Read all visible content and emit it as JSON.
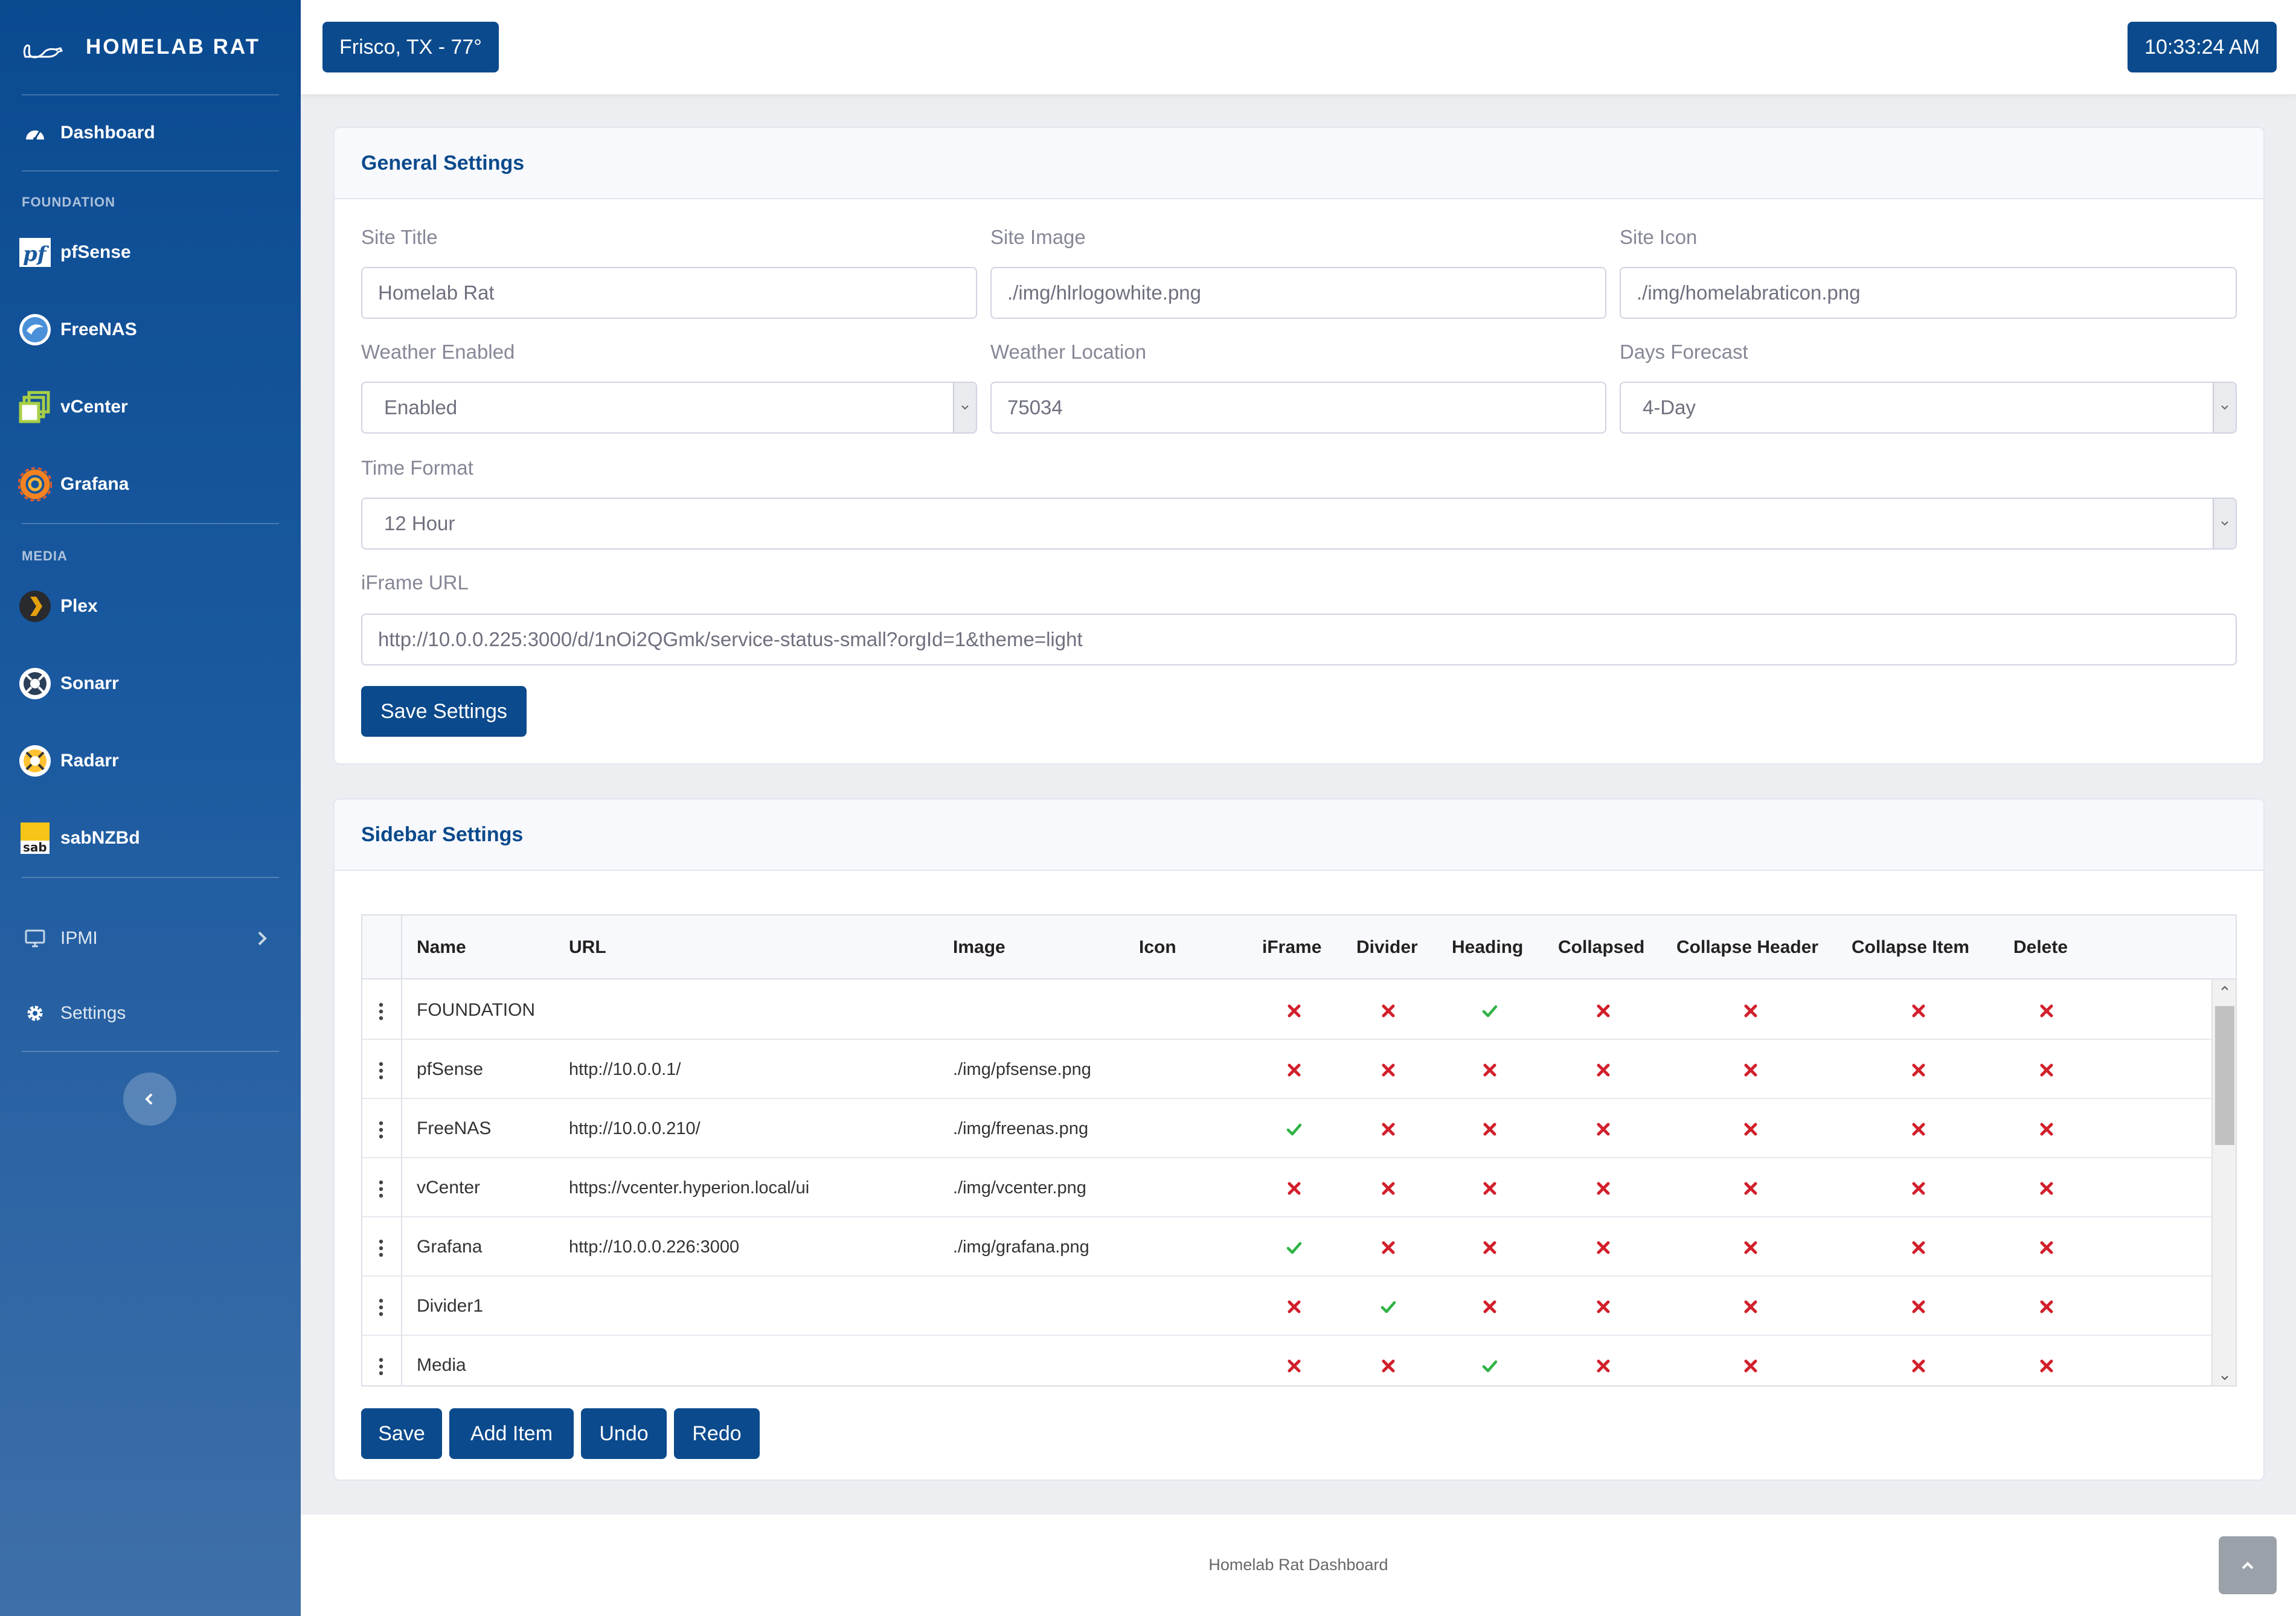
{
  "brand": {
    "name": "HOMELAB RAT"
  },
  "sidebar": {
    "dashboard": "Dashboard",
    "headings": {
      "foundation": "FOUNDATION",
      "media": "MEDIA"
    },
    "items": {
      "pfsense": "pfSense",
      "freenas": "FreeNAS",
      "vcenter": "vCenter",
      "grafana": "Grafana",
      "plex": "Plex",
      "sonarr": "Sonarr",
      "radarr": "Radarr",
      "sabnzbd": "sabNZBd",
      "ipmi": "IPMI",
      "settings": "Settings"
    },
    "sab_icon_text": "sab"
  },
  "topbar": {
    "weather": "Frisco, TX - 77°",
    "clock": "10:33:24 AM"
  },
  "general": {
    "title": "General Settings",
    "site_title": {
      "label": "Site Title",
      "value": "Homelab Rat"
    },
    "site_image": {
      "label": "Site Image",
      "value": "./img/hlrlogowhite.png"
    },
    "site_icon": {
      "label": "Site Icon",
      "value": "./img/homelabraticon.png"
    },
    "weather_enabled": {
      "label": "Weather Enabled",
      "value": "Enabled"
    },
    "weather_location": {
      "label": "Weather Location",
      "value": "75034"
    },
    "days_forecast": {
      "label": "Days Forecast",
      "value": "4-Day"
    },
    "time_format": {
      "label": "Time Format",
      "value": "12 Hour"
    },
    "iframe_url": {
      "label": "iFrame URL",
      "value": "http://10.0.0.225:3000/d/1nOi2QGmk/service-status-small?orgId=1&theme=light"
    },
    "save_label": "Save Settings"
  },
  "sidebar_settings": {
    "title": "Sidebar Settings",
    "columns": {
      "name": "Name",
      "url": "URL",
      "image": "Image",
      "icon": "Icon",
      "iframe": "iFrame",
      "divider": "Divider",
      "heading": "Heading",
      "collapsed": "Collapsed",
      "collapse_header": "Collapse Header",
      "collapse_item": "Collapse Item",
      "delete": "Delete"
    },
    "rows": [
      {
        "name": "FOUNDATION",
        "url": "",
        "image": "",
        "icon": "",
        "iframe": false,
        "divider": false,
        "heading": true,
        "collapsed": false,
        "collapse_header": false,
        "collapse_item": false,
        "delete": false
      },
      {
        "name": "pfSense",
        "url": "http://10.0.0.1/",
        "image": "./img/pfsense.png",
        "icon": "",
        "iframe": false,
        "divider": false,
        "heading": false,
        "collapsed": false,
        "collapse_header": false,
        "collapse_item": false,
        "delete": false
      },
      {
        "name": "FreeNAS",
        "url": "http://10.0.0.210/",
        "image": "./img/freenas.png",
        "icon": "",
        "iframe": true,
        "divider": false,
        "heading": false,
        "collapsed": false,
        "collapse_header": false,
        "collapse_item": false,
        "delete": false
      },
      {
        "name": "vCenter",
        "url": "https://vcenter.hyperion.local/ui",
        "image": "./img/vcenter.png",
        "icon": "",
        "iframe": false,
        "divider": false,
        "heading": false,
        "collapsed": false,
        "collapse_header": false,
        "collapse_item": false,
        "delete": false
      },
      {
        "name": "Grafana",
        "url": "http://10.0.0.226:3000",
        "image": "./img/grafana.png",
        "icon": "",
        "iframe": true,
        "divider": false,
        "heading": false,
        "collapsed": false,
        "collapse_header": false,
        "collapse_item": false,
        "delete": false
      },
      {
        "name": "Divider1",
        "url": "",
        "image": "",
        "icon": "",
        "iframe": false,
        "divider": true,
        "heading": false,
        "collapsed": false,
        "collapse_header": false,
        "collapse_item": false,
        "delete": false
      },
      {
        "name": "Media",
        "url": "",
        "image": "",
        "icon": "",
        "iframe": false,
        "divider": false,
        "heading": true,
        "collapsed": false,
        "collapse_header": false,
        "collapse_item": false,
        "delete": false
      }
    ],
    "buttons": {
      "save": "Save",
      "add": "Add Item",
      "undo": "Undo",
      "redo": "Redo"
    },
    "colors": {
      "check": "#2fb344",
      "cross": "#d21f2b"
    }
  },
  "footer": {
    "text": "Homelab Rat Dashboard"
  },
  "icons": {
    "brand": "rat-logo-icon",
    "dashboard": "tachometer-icon",
    "pfsense": "pfsense-logo-icon",
    "freenas": "freenas-logo-icon",
    "vcenter": "vcenter-logo-icon",
    "grafana": "grafana-logo-icon",
    "plex": "plex-logo-icon",
    "sonarr": "sonarr-logo-icon",
    "radarr": "radarr-logo-icon",
    "sabnzbd": "sabnzbd-logo-icon",
    "ipmi": "monitor-icon",
    "settings": "gear-icon",
    "collapse": "chevron-left-icon",
    "scroll_top": "chevron-up-icon"
  }
}
